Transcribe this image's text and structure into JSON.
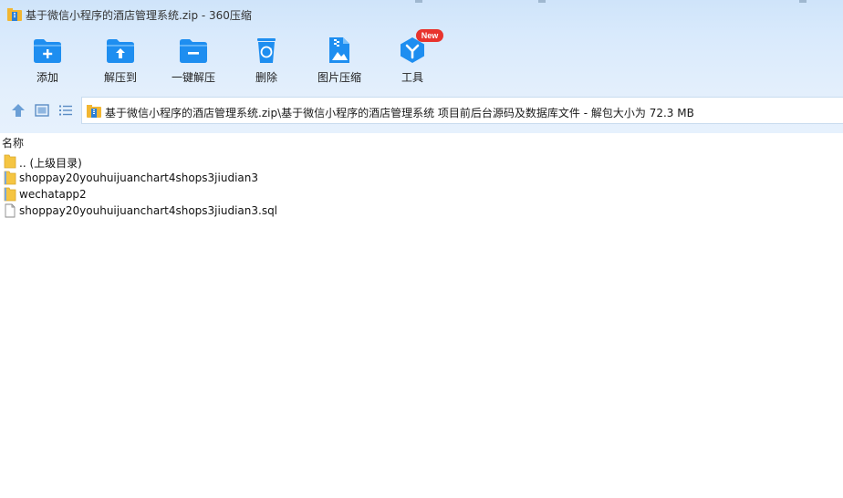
{
  "window": {
    "title": "基于微信小程序的酒店管理系统.zip - 360压缩",
    "app_icon": "archive-icon"
  },
  "toolbar": {
    "items": [
      {
        "label": "添加",
        "icon": "folder-add-icon"
      },
      {
        "label": "解压到",
        "icon": "folder-extract-icon"
      },
      {
        "label": "一键解压",
        "icon": "folder-oneclick-icon"
      },
      {
        "label": "删除",
        "icon": "recycle-bin-icon"
      },
      {
        "label": "图片压缩",
        "icon": "image-compress-icon"
      },
      {
        "label": "工具",
        "icon": "tools-icon",
        "badge": "New"
      }
    ]
  },
  "nav": {
    "up_icon": "arrow-up-icon",
    "view_thumb_icon": "thumbnail-view-icon",
    "view_list_icon": "list-view-icon",
    "path": "基于微信小程序的酒店管理系统.zip\\基于微信小程序的酒店管理系统 项目前后台源码及数据库文件 - 解包大小为 72.3 MB"
  },
  "list": {
    "columns": [
      "名称"
    ],
    "rows": [
      {
        "name": ".. (上级目录)",
        "type": "parent-folder"
      },
      {
        "name": "shoppay20youhuijuanchart4shops3jiudian3",
        "type": "folder"
      },
      {
        "name": "wechatapp2",
        "type": "folder"
      },
      {
        "name": "shoppay20youhuijuanchart4shops3jiudian3.sql",
        "type": "file"
      }
    ]
  },
  "colors": {
    "accent": "#1e8ef0",
    "toolbar_bg": "#dbeafc",
    "badge": "#e8342e",
    "folder": "#f5c542"
  }
}
